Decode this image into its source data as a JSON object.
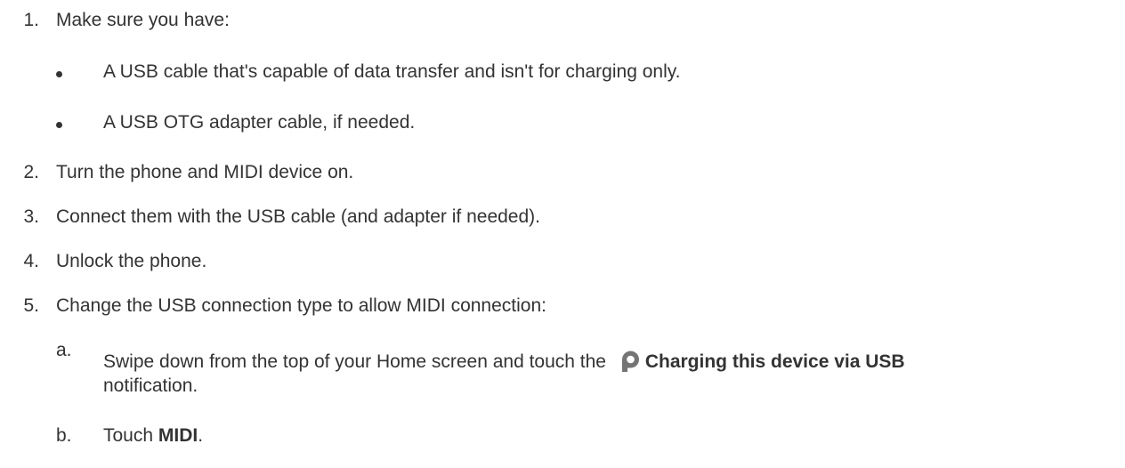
{
  "steps": [
    {
      "num": "1.",
      "text": "Make sure you have:"
    },
    {
      "num": "2.",
      "text": "Turn the phone and MIDI device on."
    },
    {
      "num": "3.",
      "text": "Connect them with the USB cable (and adapter if needed)."
    },
    {
      "num": "4.",
      "text": "Unlock the phone."
    },
    {
      "num": "5.",
      "text": "Change the USB connection type to allow MIDI connection:"
    }
  ],
  "bullets": [
    "A USB cable that's capable of data transfer and isn't for charging only.",
    "A USB OTG adapter cable, if needed."
  ],
  "substeps": {
    "a": {
      "letter": "a.",
      "text_before": "Swipe down from the top of your Home screen and touch the",
      "bold": "Charging this device via USB",
      "text_after": "notification.",
      "icon": "pixel-p-icon"
    },
    "b": {
      "letter": "b.",
      "text_before": "Touch",
      "bold": "MIDI",
      "text_after": "."
    }
  },
  "colors": {
    "text": "#333333",
    "icon": "#757575"
  }
}
